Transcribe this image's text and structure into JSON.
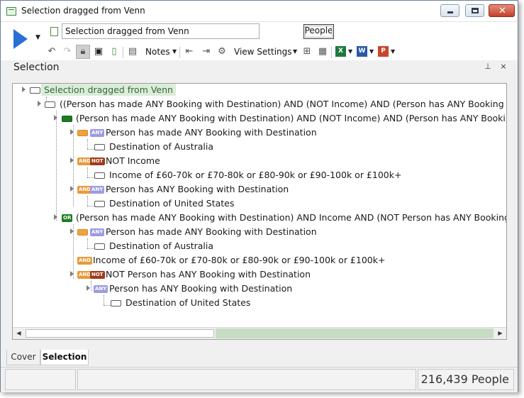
{
  "window": {
    "title": "Selection dragged from Venn"
  },
  "toolbar": {
    "selection_name": "Selection dragged from Venn",
    "people_button": "People",
    "notes_label": "Notes",
    "view_settings_label": "View Settings"
  },
  "panel": {
    "title": "Selection",
    "pin_glyph": "⊥",
    "close_glyph": "×"
  },
  "tree": {
    "root": "Selection dragged from Venn",
    "n1": "((Person has made ANY Booking with Destination) AND (NOT Income) AND (Person has ANY Booking",
    "n2": "(Person has made ANY Booking with Destination) AND (NOT Income) AND (Person has ANY Bookin",
    "n3": "Person has made ANY Booking with Destination",
    "n4": "Destination of Australia",
    "n5": "NOT Income",
    "n6": "Income of £60-70k or £70-80k or £80-90k or £90-100k or £100k+",
    "n7": "Person has ANY Booking with Destination",
    "n8": "Destination of United States",
    "n9": "(Person has made ANY Booking with Destination) AND Income AND (NOT Person has ANY Booking",
    "n10": "Person has made ANY Booking with Destination",
    "n11": "Destination of Australia",
    "n12": "Income of £60-70k or £70-80k or £80-90k or £90-100k or £100k+",
    "n13": "NOT Person has ANY Booking with Destination",
    "n14": "Person has ANY Booking with Destination",
    "n15": "Destination of United States"
  },
  "badges": {
    "any": "ANY",
    "and": "AND",
    "not": "NOT",
    "or": "OR"
  },
  "tabs": {
    "cover": "Cover",
    "selection": "Selection"
  },
  "status": {
    "count": "216,439 People"
  },
  "colors": {
    "accent_green": "#1e7d22",
    "play_blue": "#2a6fd6",
    "scroll_track": "#c7ddc3"
  }
}
